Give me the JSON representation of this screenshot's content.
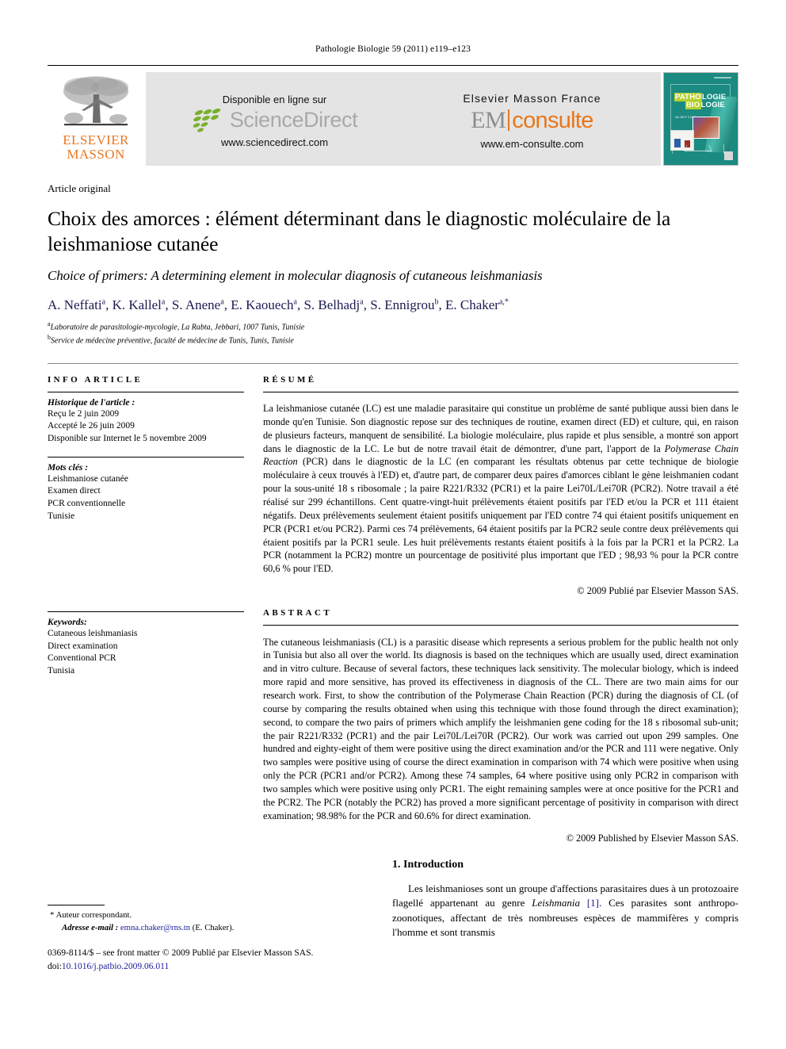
{
  "running_head": "Pathologie Biologie 59 (2011) e119–e123",
  "masthead": {
    "elsevier_line1": "ELSEVIER",
    "elsevier_line2": "MASSON",
    "sciencedirect": {
      "available_text": "Disponible en ligne sur",
      "logo_word": "ScienceDirect",
      "url": "www.sciencedirect.com"
    },
    "emconsulte": {
      "publisher_text": "Elsevier Masson France",
      "logo_em": "EM",
      "logo_consulte": "consulte",
      "url": "www.em-consulte.com"
    },
    "cover": {
      "title_line1_a": "PATHO",
      "title_line1_b": "LOGIE",
      "title_line2_a": "BIO",
      "title_line2_b": "LOGIE",
      "small_meta": "Vol. 59 N° 3 2011",
      "background_color": "#1b8a80",
      "accent_color": "#b5cf2e"
    }
  },
  "article": {
    "type": "Article original",
    "title_fr": "Choix des amorces : élément déterminant dans le diagnostic moléculaire de la leishmaniose cutanée",
    "title_en": "Choice of primers: A determining element in molecular diagnosis of cutaneous leishmaniasis",
    "authors": [
      {
        "name": "A. Neffati",
        "sup": "a"
      },
      {
        "name": "K. Kallel",
        "sup": "a"
      },
      {
        "name": "S. Anene",
        "sup": "a"
      },
      {
        "name": "E. Kaouech",
        "sup": "a"
      },
      {
        "name": "S. Belhadj",
        "sup": "a"
      },
      {
        "name": "S. Ennigrou",
        "sup": "b"
      },
      {
        "name": "E. Chaker",
        "sup": "a,*"
      }
    ],
    "affiliations": [
      {
        "mark": "a",
        "text": "Laboratoire de parasitologie-mycologie, La Rabta, Jebbari, 1007 Tunis, Tunisie"
      },
      {
        "mark": "b",
        "text": "Service de médecine préventive, faculté de médecine de Tunis, Tunis, Tunisie"
      }
    ]
  },
  "info_article": {
    "heading": "INFO ARTICLE",
    "history_label": "Historique de l'article :",
    "history_lines": [
      "Reçu le 2 juin 2009",
      "Accepté le 26 juin 2009",
      "Disponible sur Internet le 5 novembre 2009"
    ],
    "keywords_label": "Mots clés :",
    "keywords": [
      "Leishmaniose cutanée",
      "Examen direct",
      "PCR conventionnelle",
      "Tunisie"
    ],
    "keywords_en_label": "Keywords:",
    "keywords_en": [
      "Cutaneous leishmaniasis",
      "Direct examination",
      "Conventional PCR",
      "Tunisia"
    ]
  },
  "resume": {
    "heading": "RÉSUMÉ",
    "part1": "La leishmaniose cutanée (LC) est une maladie parasitaire qui constitue un problème de santé publique aussi bien dans le monde qu'en Tunisie. Son diagnostic repose sur des techniques de routine, examen direct (ED) et culture, qui, en raison de plusieurs facteurs, manquent de sensibilité. La biologie moléculaire, plus rapide et plus sensible, a montré son apport dans le diagnostic de la LC. Le but de notre travail était de démontrer, d'une part, l'apport de la ",
    "italic1": "Polymerase Chain Reaction",
    "part2": " (PCR) dans le diagnostic de la LC (en comparant les résultats obtenus par cette technique de biologie moléculaire à ceux trouvés à l'ED) et, d'autre part, de comparer deux paires d'amorces ciblant le gène leishmanien codant pour la sous-unité 18 s ribosomale ; la paire R221/R332 (PCR1) et la paire Lei70L/Lei70R (PCR2). Notre travail a été réalisé sur 299 échantillons. Cent quatre-vingt-huit prélèvements étaient positifs par l'ED et/ou la PCR et 111 étaient négatifs. Deux prélèvements seulement étaient positifs uniquement par l'ED contre 74 qui étaient positifs uniquement en PCR (PCR1 et/ou PCR2). Parmi ces 74 prélèvements, 64 étaient positifs par la PCR2 seule contre deux prélèvements qui étaient positifs par la PCR1 seule. Les huit prélèvements restants étaient positifs à la fois par la PCR1 et la PCR2. La PCR (notamment la PCR2) montre un pourcentage de positivité plus important que l'ED ; 98,93 % pour la PCR contre 60,6 % pour l'ED.",
    "copyright": "© 2009 Publié par Elsevier Masson SAS."
  },
  "abstract": {
    "heading": "ABSTRACT",
    "text": "The cutaneous leishmaniasis (CL) is a parasitic disease which represents a serious problem for the public health not only in Tunisia but also all over the world. Its diagnosis is based on the techniques which are usually used, direct examination and in vitro culture. Because of several factors, these techniques lack sensitivity. The molecular biology, which is indeed more rapid and more sensitive, has proved its effectiveness in diagnosis of the CL. There are two main aims for our research work. First, to show the contribution of the Polymerase Chain Reaction (PCR) during the diagnosis of CL (of course by comparing the results obtained when using this technique with those found through the direct examination); second, to compare the two pairs of primers which amplify the leishmanien gene coding for the 18 s ribosomal sub-unit; the pair R221/R332 (PCR1) and the pair Lei70L/Lei70R (PCR2). Our work was carried out upon 299 samples. One hundred and eighty-eight of them were positive using the direct examination and/or the PCR and 111 were negative. Only two samples were positive using of course the direct examination in comparison with 74 which were positive when using only the PCR (PCR1 and/or PCR2). Among these 74 samples, 64 where positive using only PCR2 in comparison with two samples which were positive using only PCR1. The eight remaining samples were at once positive for the PCR1 and the PCR2. The PCR (notably the PCR2) has proved a more significant percentage of positivity in comparison with direct examination; 98.98% for the PCR and 60.6% for direct examination.",
    "copyright": "© 2009 Published by Elsevier Masson SAS."
  },
  "introduction": {
    "heading": "1. Introduction",
    "paragraph_a": "Les leishmanioses sont un groupe d'affections parasitaires dues à un protozoaire flagellé appartenant au genre ",
    "genus_italic": "Leishmania",
    "ref": " [1]",
    "paragraph_b": ". Ces parasites sont anthropo-zoonotiques, affectant de très nombreuses espèces de mammifères y compris l'homme et sont transmis"
  },
  "footnotes": {
    "corresponding_star": "*",
    "corresponding_label": "Auteur correspondant.",
    "email_label": "Adresse e-mail :",
    "email": "emna.chaker@rns.tn",
    "email_suffix": "(E. Chaker).",
    "issn_line": "0369-8114/$ – see front matter © 2009 Publié par Elsevier Masson SAS.",
    "doi_label": "doi:",
    "doi": "10.1016/j.patbio.2009.06.011"
  }
}
